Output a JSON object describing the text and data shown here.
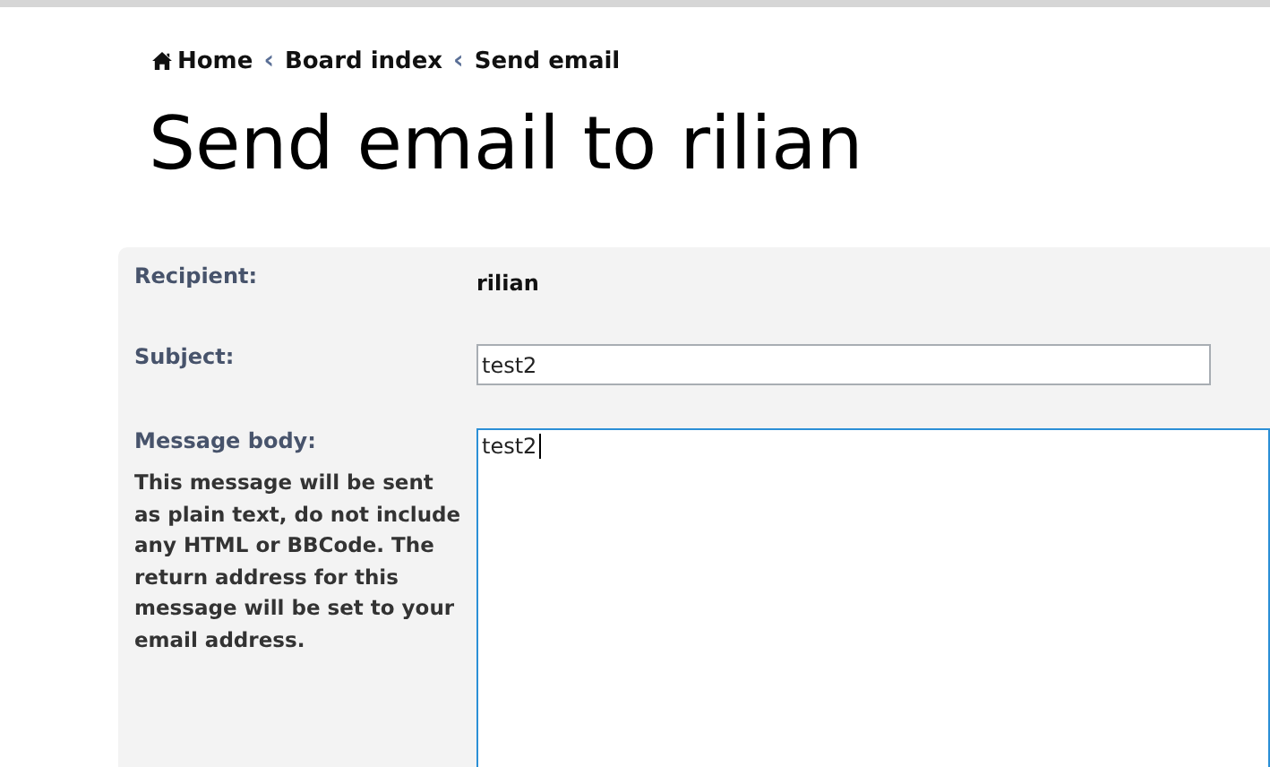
{
  "breadcrumbs": [
    {
      "label": "Home"
    },
    {
      "label": "Board index"
    },
    {
      "label": "Send email"
    }
  ],
  "breadcrumb_separator": "‹",
  "title": "Send email to rilian",
  "form": {
    "recipient": {
      "label": "Recipient:",
      "value": "rilian"
    },
    "subject": {
      "label": "Subject:",
      "value": "test2"
    },
    "message": {
      "label": "Message body:",
      "explain": "This message will be sent as plain text, do not include any HTML or BBCode. The return address for this message will be set to your email address.",
      "value": "test2",
      "focused": true
    }
  }
}
